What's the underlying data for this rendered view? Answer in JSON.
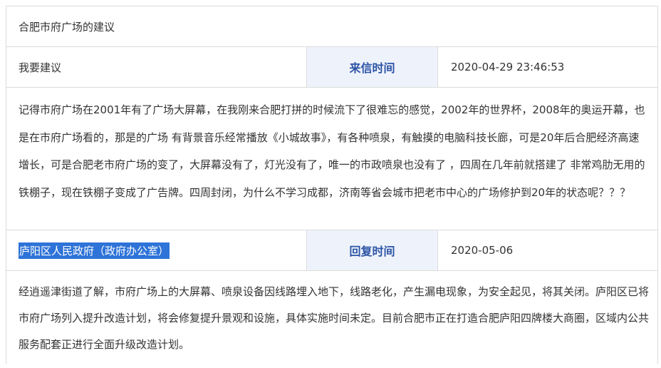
{
  "title": "合肥市府广场的建议",
  "letter": {
    "category": "我要建议",
    "time_label": "来信时间",
    "time_value": "2020-04-29 23:46:53",
    "content": "记得市府广场在2001年有了广场大屏幕，在我刚来合肥打拼的时候流下了很难忘的感觉，2002年的世界杯，2008年的奥运开幕，也是在市府广场看的，那是的广场 有背景音乐经常播放《小城故事》，有各种喷泉，有触摸的电脑科技长廊，可是20年后合肥经济高速增长，可是合肥老市府广场的变了，大屏幕没有了，灯光没有了，唯一的市政喷泉也没有了 ，四周在几年前就搭建了 非常鸡肋无用的铁棚子，现在铁棚子变成了广告牌。四周封闭，为什么不学习成都，济南等省会城市把老市中心的广场修护到20年的状态呢？？？"
  },
  "reply": {
    "department": "庐阳区人民政府（政府办公室）",
    "time_label": "回复时间",
    "time_value": "2020-05-06",
    "content": "经逍遥津街道了解，市府广场上的大屏幕、喷泉设备因线路埋入地下，线路老化，产生漏电现象，为安全起见，将其关闭。庐阳区已将市府广场列入提升改造计划，将会修复提升景观和设施，具体实施时间未定。目前合肥市正在打造合肥庐阳四牌楼大商圈，区域内公共服务配套正进行全面升级改造计划。"
  },
  "colors": {
    "label_background": "#eef2fb",
    "label_text": "#2c54a5",
    "selection": "#2e73d8",
    "border": "#dcdcdc"
  }
}
